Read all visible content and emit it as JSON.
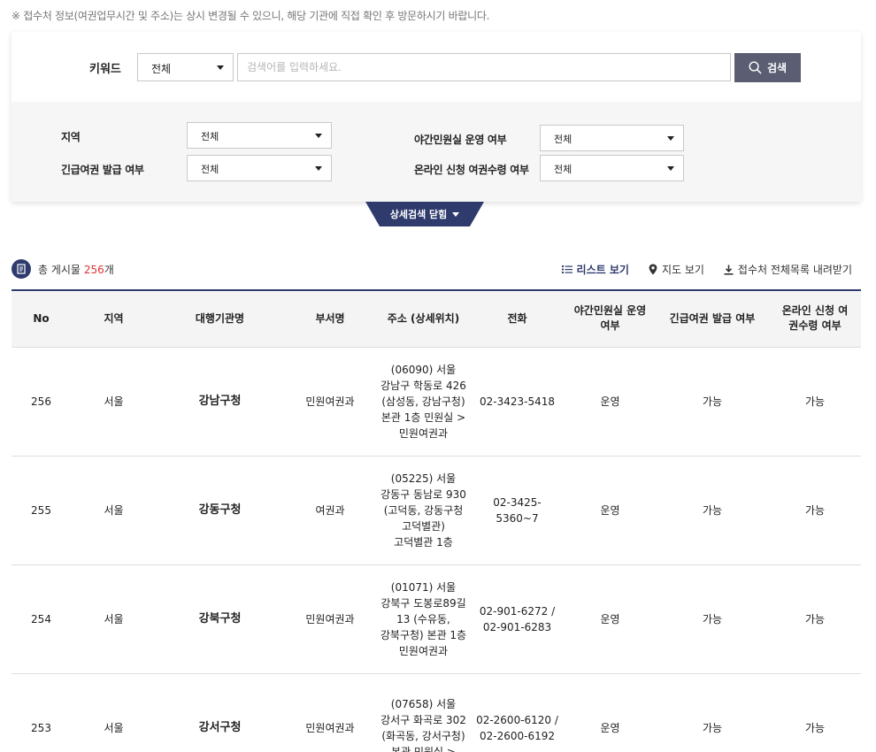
{
  "notice": "※ 접수처 정보(여권업무시간 및 주소)는 상시 변경될 수 있으니, 해당 기관에 직접 확인 후 방문하시기 바랍니다.",
  "search": {
    "keyword_label": "키워드",
    "keyword_select": "전체",
    "placeholder": "검색어를 입력하세요.",
    "button_label": "검색"
  },
  "filters": {
    "region_label": "지역",
    "region_value": "전체",
    "emergency_label": "긴급여권 발급 여부",
    "emergency_value": "전체",
    "night_label": "야간민원실 운영 여부",
    "night_value": "전체",
    "online_label": "온라인 신청 여권수령 여부",
    "online_value": "전체"
  },
  "toggle_label": "상세검색 닫힘",
  "summary": {
    "prefix": "총 게시물",
    "count": "256",
    "suffix": "개"
  },
  "views": {
    "list": "리스트 보기",
    "map": "지도 보기",
    "download": "접수처 전체목록 내려받기"
  },
  "table": {
    "headers": [
      "No",
      "지역",
      "대행기관명",
      "부서명",
      "주소 (상세위치)",
      "전화",
      "야간민원실 운영 여부",
      "긴급여권 발급 여부",
      "온라인 신청 여권수령 여부"
    ],
    "rows": [
      {
        "no": "256",
        "region": "서울",
        "agency": "강남구청",
        "dept": "민원여권과",
        "address": "(06090) 서울\n강남구 학동로 426\n(삼성동, 강남구청)\n본관 1층 민원실 >\n민원여권과",
        "phone": "02-3423-5418",
        "night": "운영",
        "emergency": "가능",
        "online": "가능"
      },
      {
        "no": "255",
        "region": "서울",
        "agency": "강동구청",
        "dept": "여권과",
        "address": "(05225) 서울\n강동구 동남로 930\n(고덕동, 강동구청\n고덕별관)\n고덕별관 1층",
        "phone": "02-3425-\n5360~7",
        "night": "운영",
        "emergency": "가능",
        "online": "가능"
      },
      {
        "no": "254",
        "region": "서울",
        "agency": "강북구청",
        "dept": "민원여권과",
        "address": "(01071) 서울\n강북구 도봉로89길\n13 (수유동,\n강북구청) 본관 1층\n민원여권과",
        "phone": "02-901-6272 /\n02-901-6283",
        "night": "운영",
        "emergency": "가능",
        "online": "가능"
      },
      {
        "no": "253",
        "region": "서울",
        "agency": "강서구청",
        "dept": "민원여권과",
        "address": "(07658) 서울\n강서구 화곡로 302\n(화곡동, 강서구청)\n본관 민원실 >",
        "phone": "02-2600-6120 /\n02-2600-6192",
        "night": "운영",
        "emergency": "가능",
        "online": "가능"
      }
    ]
  },
  "colors": {
    "navy": "#2f3b6d",
    "search_button": "#5b5e72",
    "count_red": "#dd3333"
  }
}
